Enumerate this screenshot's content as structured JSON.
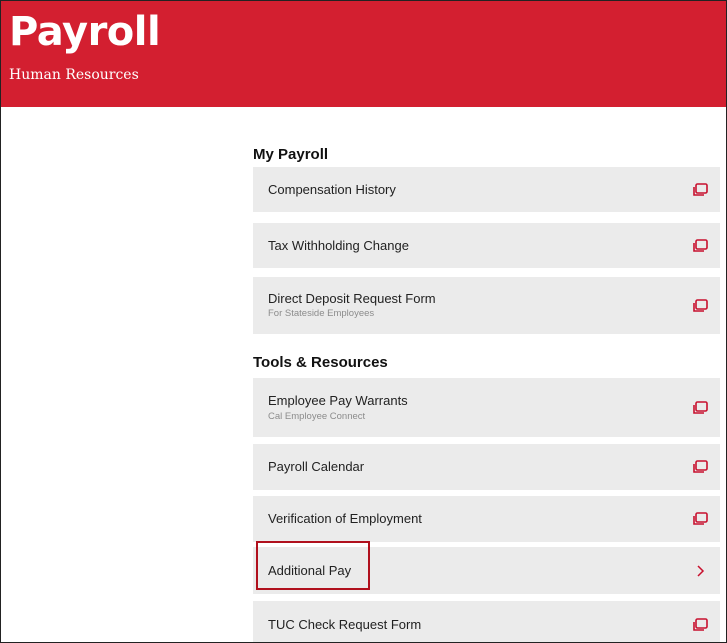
{
  "header": {
    "title": "Payroll",
    "subtitle": "Human Resources"
  },
  "sections": [
    {
      "heading": "My Payroll",
      "items": [
        {
          "label": "Compensation History",
          "sublabel": "",
          "icon": "external-link-icon"
        },
        {
          "label": "Tax Withholding Change",
          "sublabel": "",
          "icon": "external-link-icon"
        },
        {
          "label": "Direct Deposit Request Form",
          "sublabel": "For Stateside Employees",
          "icon": "external-link-icon"
        }
      ]
    },
    {
      "heading": "Tools & Resources",
      "items": [
        {
          "label": "Employee Pay Warrants",
          "sublabel": "Cal Employee Connect",
          "icon": "external-link-icon"
        },
        {
          "label": "Payroll Calendar",
          "sublabel": "",
          "icon": "external-link-icon"
        },
        {
          "label": "Verification of Employment",
          "sublabel": "",
          "icon": "external-link-icon"
        },
        {
          "label": "Additional Pay",
          "sublabel": "",
          "icon": "chevron-right-icon"
        },
        {
          "label": "TUC Check Request Form",
          "sublabel": "",
          "icon": "external-link-icon"
        }
      ]
    }
  ],
  "colors": {
    "brand_red": "#d31f30",
    "item_bg": "#ebebeb",
    "icon_red": "#c8102e",
    "highlight_border": "#b0101d"
  }
}
